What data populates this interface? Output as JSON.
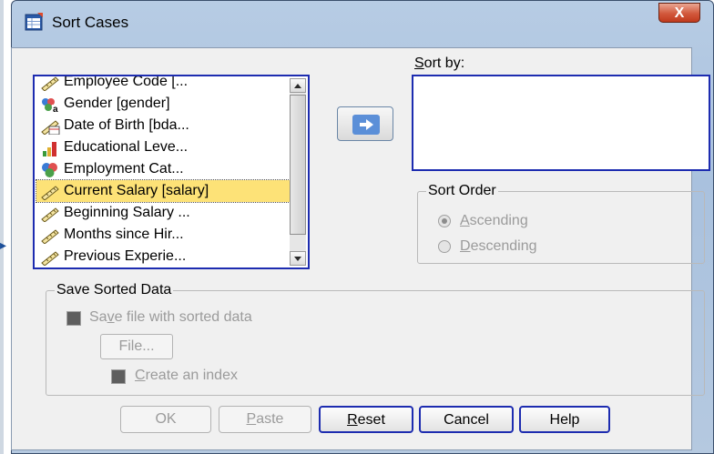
{
  "window": {
    "title": "Sort Cases",
    "close_glyph": "X"
  },
  "variables": [
    {
      "label": "Employee Code [...",
      "icon": "ruler-scale-icon"
    },
    {
      "label": "Gender [gender]",
      "icon": "nominal-string-icon"
    },
    {
      "label": "Date of Birth [bda...",
      "icon": "date-scale-icon"
    },
    {
      "label": "Educational Leve...",
      "icon": "ordinal-bars-icon"
    },
    {
      "label": "Employment Cat...",
      "icon": "nominal-circles-icon"
    },
    {
      "label": "Current Salary [salary]",
      "icon": "ruler-scale-icon",
      "selected": true
    },
    {
      "label": "Beginning Salary ...",
      "icon": "ruler-scale-icon"
    },
    {
      "label": "Months since Hir...",
      "icon": "ruler-scale-icon"
    },
    {
      "label": "Previous Experie...",
      "icon": "ruler-scale-icon"
    }
  ],
  "sort_by": {
    "label": "Sort by:",
    "items": []
  },
  "sort_order": {
    "title": "Sort Order",
    "ascending": "Ascending",
    "descending": "Descending",
    "selected": "Ascending"
  },
  "save_sorted": {
    "title": "Save Sorted Data",
    "save_file": "Save file with sorted data",
    "file_button": "File...",
    "create_index": "Create an index"
  },
  "buttons": {
    "ok": "OK",
    "paste": "Paste",
    "reset": "Reset",
    "cancel": "Cancel",
    "help": "Help"
  },
  "colors": {
    "accent": "#1d2cb0",
    "selection": "#fde277",
    "disabled_text": "#9b9b9b"
  }
}
